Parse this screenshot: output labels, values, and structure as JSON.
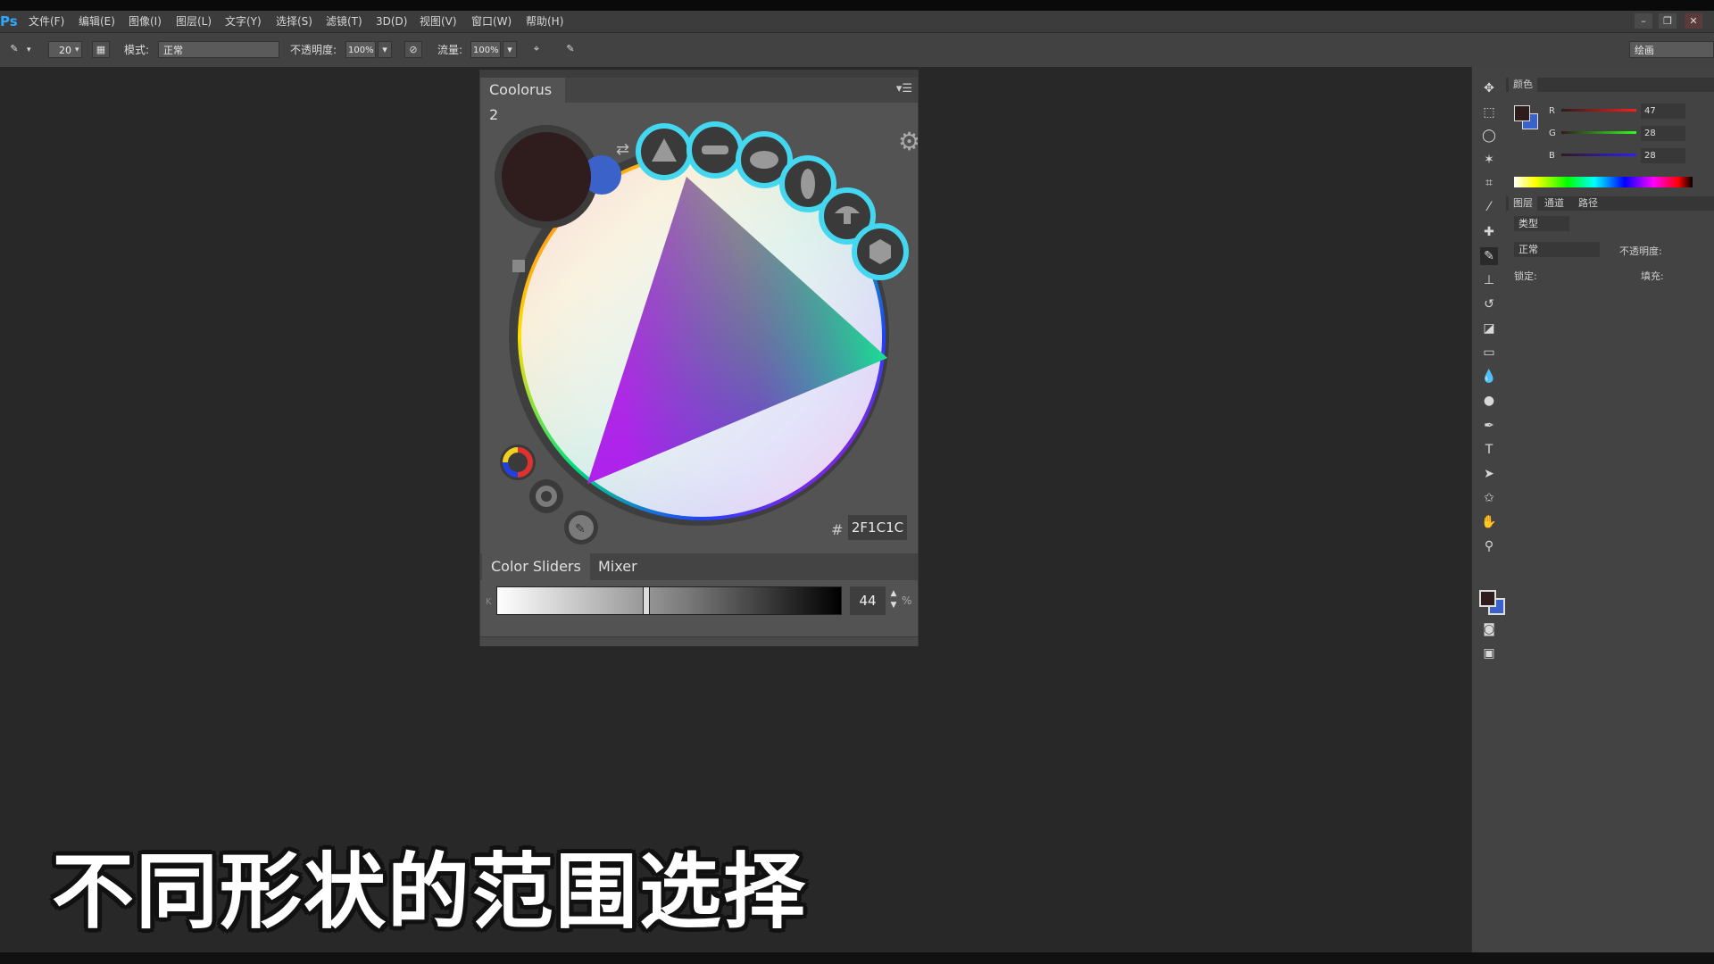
{
  "app": {
    "logo_text": "Ps"
  },
  "menu": {
    "items": [
      "文件(F)",
      "编辑(E)",
      "图像(I)",
      "图层(L)",
      "文字(Y)",
      "选择(S)",
      "滤镜(T)",
      "3D(D)",
      "视图(V)",
      "窗口(W)",
      "帮助(H)"
    ]
  },
  "options_bar": {
    "brush_size": "20",
    "mode_label": "模式:",
    "mode_value": "正常",
    "opacity_label": "不透明度:",
    "opacity_value": "100%",
    "flow_label": "流量:",
    "flow_value": "100%",
    "workspace_value": "绘画"
  },
  "coolorus": {
    "tab_title": "Coolorus 2",
    "hex_prefix": "#",
    "hex_value": "2F1C1C",
    "primary_color": "#2f1c1c",
    "secondary_color": "#3a62c8",
    "gamut_shapes": [
      "triangle-shape",
      "bar-shape",
      "ellipse-shape",
      "lens-shape",
      "mushroom-shape",
      "hexagon-shape"
    ],
    "slider_tabs": [
      "Color Sliders",
      "Mixer"
    ],
    "k_label": "K",
    "k_value": "44",
    "k_unit": "%",
    "k_fraction": 0.44
  },
  "color_panel": {
    "tab": "颜色",
    "r_label": "R",
    "r_value": "47",
    "g_label": "G",
    "g_value": "28",
    "b_label": "B",
    "b_value": "28",
    "fg_color": "#2f1c1c",
    "bg_color": "#3a62c8"
  },
  "layers_panel": {
    "tabs": [
      "图层",
      "通道",
      "路径"
    ],
    "filter_label": "类型",
    "blend_value": "正常",
    "opacity_label": "不透明度:",
    "lock_label": "锁定:",
    "fill_label": "填充:"
  },
  "subtitle": "不同形状的范围选择"
}
